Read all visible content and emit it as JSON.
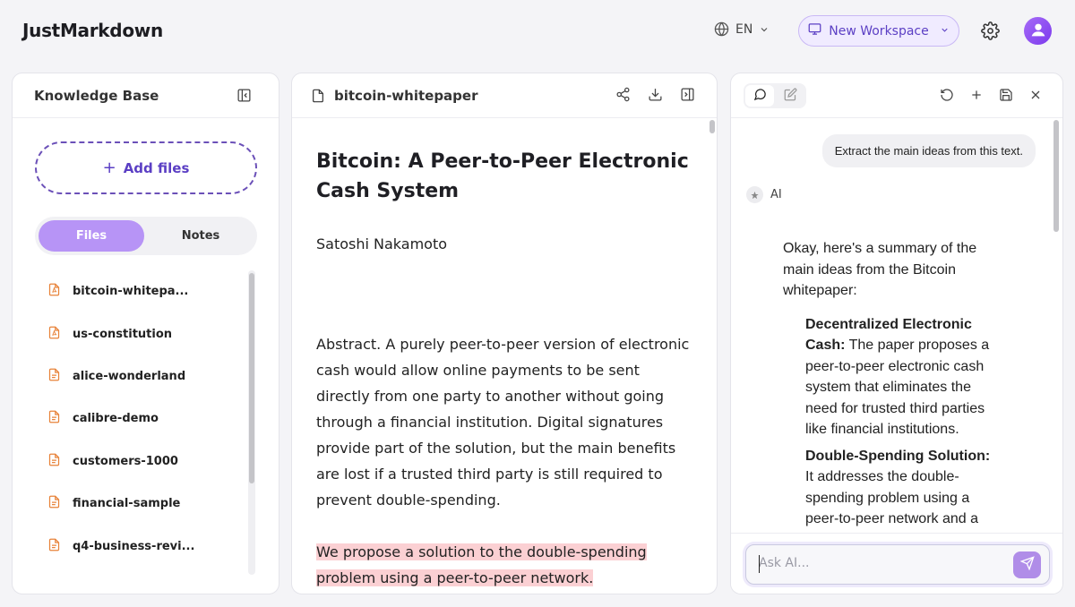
{
  "app": {
    "name": "JustMarkdown",
    "language": "EN",
    "workspace_label": "New Workspace"
  },
  "knowledge_base": {
    "title": "Knowledge Base",
    "add_files_label": "Add files",
    "tabs": {
      "files": "Files",
      "notes": "Notes",
      "active": "Files"
    },
    "files": [
      {
        "name": "bitcoin-whitepa...",
        "type": "pdf"
      },
      {
        "name": "us-constitution",
        "type": "pdf"
      },
      {
        "name": "alice-wonderland",
        "type": "doc"
      },
      {
        "name": "calibre-demo",
        "type": "doc"
      },
      {
        "name": "customers-1000",
        "type": "doc"
      },
      {
        "name": "financial-sample",
        "type": "doc"
      },
      {
        "name": "q4-business-revi...",
        "type": "doc"
      }
    ]
  },
  "document": {
    "filename": "bitcoin-whitepaper",
    "title": "Bitcoin: A Peer-to-Peer Electronic Cash System",
    "author": "Satoshi Nakamoto",
    "abstract": "Abstract.  A purely peer-to-peer version of electronic cash would allow online payments to be sent directly from one party to another without going through a financial institution.  Digital signatures provide part of the solution, but the main benefits are lost if a trusted third party is still required to prevent double-spending.",
    "highlighted": "We propose a solution to the double-spending problem using a peer-to-peer network."
  },
  "chat": {
    "user_message": "Extract the main ideas from this text.",
    "ai_label": "AI",
    "ai_intro": "Okay, here's a summary of the main ideas from the Bitcoin whitepaper:",
    "ai_points": [
      {
        "title": "Decentralized Electronic Cash:",
        "text": " The paper proposes a peer-to-peer electronic cash system that eliminates the need for trusted third parties like financial institutions."
      },
      {
        "title": "Double-Spending Solution:",
        "text": " It addresses the double-spending problem using a peer-to-peer network and a"
      }
    ],
    "input_placeholder": "Ask AI..."
  },
  "colors": {
    "accent": "#5b3fc4",
    "accent_light": "#b794f6",
    "highlight": "#fbd0d3",
    "file_icon": "#e8833a"
  }
}
